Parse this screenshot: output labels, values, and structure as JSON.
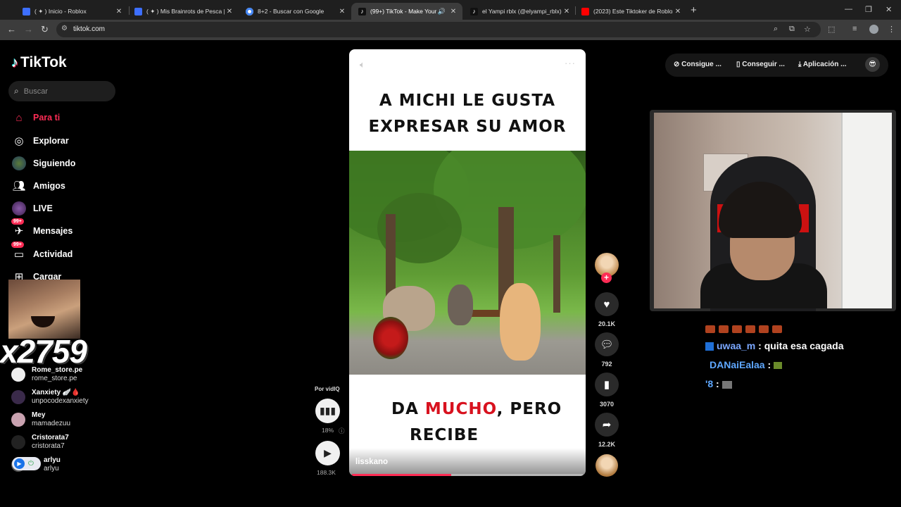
{
  "browser": {
    "tabs": [
      {
        "title": "( ✦ ) Inicio - Roblox",
        "icon": "roblox-icon",
        "color": "#3d6fff"
      },
      {
        "title": "( ✦ ) Mis Brainrots de Pesca | El",
        "icon": "roblox-icon",
        "color": "#3d6fff"
      },
      {
        "title": "8+2 - Buscar con Google",
        "icon": "google-icon",
        "color": "#4285f4"
      },
      {
        "title": "(99+) TikTok - Make Your Da",
        "icon": "tiktok-icon",
        "color": "#ffffff"
      },
      {
        "title": "el Yampi rblx (@elyampi_rblx) |",
        "icon": "tiktok-icon",
        "color": "#ffffff"
      },
      {
        "title": "(2023) Este Tiktoker de Roblox",
        "icon": "youtube-icon",
        "color": "#ff0000"
      }
    ],
    "url": "tiktok.com"
  },
  "sidebar": {
    "logo": "TikTok",
    "search_placeholder": "Buscar",
    "nav": [
      {
        "label": "Para ti",
        "icon": "home-icon",
        "active": true
      },
      {
        "label": "Explorar",
        "icon": "compass-icon"
      },
      {
        "label": "Siguiendo",
        "icon": "following-avatar-icon"
      },
      {
        "label": "Amigos",
        "icon": "friends-icon"
      },
      {
        "label": "LIVE",
        "icon": "live-icon"
      },
      {
        "label": "Mensajes",
        "icon": "messages-icon",
        "badge": "99+"
      },
      {
        "label": "Actividad",
        "icon": "activity-icon",
        "badge": "99+"
      },
      {
        "label": "Cargar",
        "icon": "upload-icon"
      }
    ],
    "overlay_counter": "x2759",
    "following": [
      {
        "name": "Rome_store.pe",
        "handle": "rome_store.pe"
      },
      {
        "name": "Xanxiety 🪽🩸",
        "handle": "unpocodexanxiety"
      },
      {
        "name": "Mey",
        "handle": "mamadezuu"
      },
      {
        "name": "Cristorata7",
        "handle": "cristorata7"
      },
      {
        "name": "arlyu",
        "handle": "arlyu"
      }
    ]
  },
  "video": {
    "caption_top": [
      "A MICHI LE GUSTA",
      "EXPRESAR SU AMOR"
    ],
    "caption_bottom_pre": "DA ",
    "caption_bottom_highlight": "MUCHO",
    "caption_bottom_post": ", PERO",
    "caption_bottom_line2": "RECIBE",
    "author": "lisskano",
    "progress": 0.43
  },
  "actions": {
    "likes": "20.1K",
    "comments": "792",
    "saves": "3070",
    "shares": "12.2K"
  },
  "vidiq": {
    "label": "Por vidIQ",
    "percent": "18%",
    "views": "188.3K"
  },
  "header": {
    "coins_btn": "Consigue ...",
    "app_btn": "Conseguir ...",
    "download_btn": "Aplicación ..."
  },
  "chat": [
    {
      "user": "uwaa_m",
      "message": ": quita esa cagada"
    },
    {
      "user": "DANaiEalaa",
      "message": ":"
    },
    {
      "user": "'8",
      "message": ":"
    }
  ],
  "colors": {
    "accent": "#fe2c55",
    "bg": "#000000"
  }
}
